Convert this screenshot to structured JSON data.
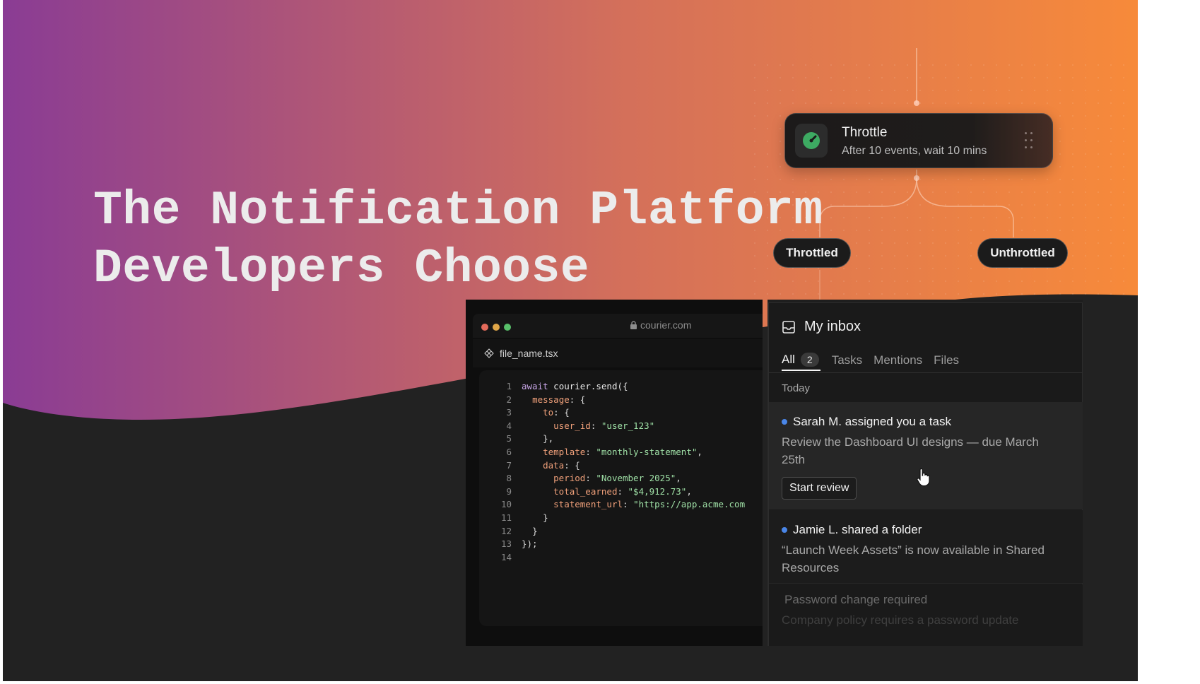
{
  "headline": {
    "line1": "The Notification Platform",
    "line2": "Developers Choose"
  },
  "workflow": {
    "throttle": {
      "title": "Throttle",
      "subtitle": "After 10 events, wait 10 mins",
      "icon": "gauge-icon"
    },
    "branches": {
      "left": "Throttled",
      "right": "Unthrottled"
    }
  },
  "browser": {
    "url": "courier.com",
    "file_name": "file_name.tsx"
  },
  "code": {
    "lines": [
      {
        "n": "1"
      },
      {
        "n": "2"
      },
      {
        "n": "3"
      },
      {
        "n": "4"
      },
      {
        "n": "5"
      },
      {
        "n": "6"
      },
      {
        "n": "7"
      },
      {
        "n": "8"
      },
      {
        "n": "9"
      },
      {
        "n": "10"
      },
      {
        "n": "11"
      },
      {
        "n": "12"
      },
      {
        "n": "13"
      },
      {
        "n": "14"
      }
    ],
    "tokens": {
      "await": "await",
      "call": " courier.send({",
      "message": "message",
      "to": "to",
      "user_id": "user_id",
      "user_id_val": "\"user_123\"",
      "template": "template",
      "template_val": "\"monthly-statement\"",
      "data": "data",
      "period": "period",
      "period_val": "\"November 2025\"",
      "total_earned": "total_earned",
      "total_earned_val": "\"$4,912.73\"",
      "statement_url": "statement_url",
      "statement_url_val": "\"https://app.acme.com",
      "close_obj": "},",
      "close_brace": "}",
      "close_call": "});",
      "colon_brace": ": {",
      "colon": ": ",
      "comma": ","
    }
  },
  "inbox": {
    "title": "My inbox",
    "tabs": [
      {
        "label": "All",
        "count": "2"
      },
      {
        "label": "Tasks"
      },
      {
        "label": "Mentions"
      },
      {
        "label": "Files"
      }
    ],
    "section": "Today",
    "messages": [
      {
        "title": "Sarah M. assigned you a task",
        "body": "Review the Dashboard UI designs — due March 25th",
        "action": "Start review"
      },
      {
        "title": "Jamie L. shared a folder",
        "body": "“Launch Week Assets” is now available in Shared Resources"
      },
      {
        "title": "Password change required",
        "body": "Company policy requires a password update"
      }
    ]
  },
  "colors": {
    "gradient_start": "#8a3c94",
    "gradient_mid": "#d4705a",
    "gradient_end": "#f78a3a",
    "dark_band": "#222222",
    "accent_green": "#3daa62",
    "unread_blue": "#4a86e8"
  }
}
